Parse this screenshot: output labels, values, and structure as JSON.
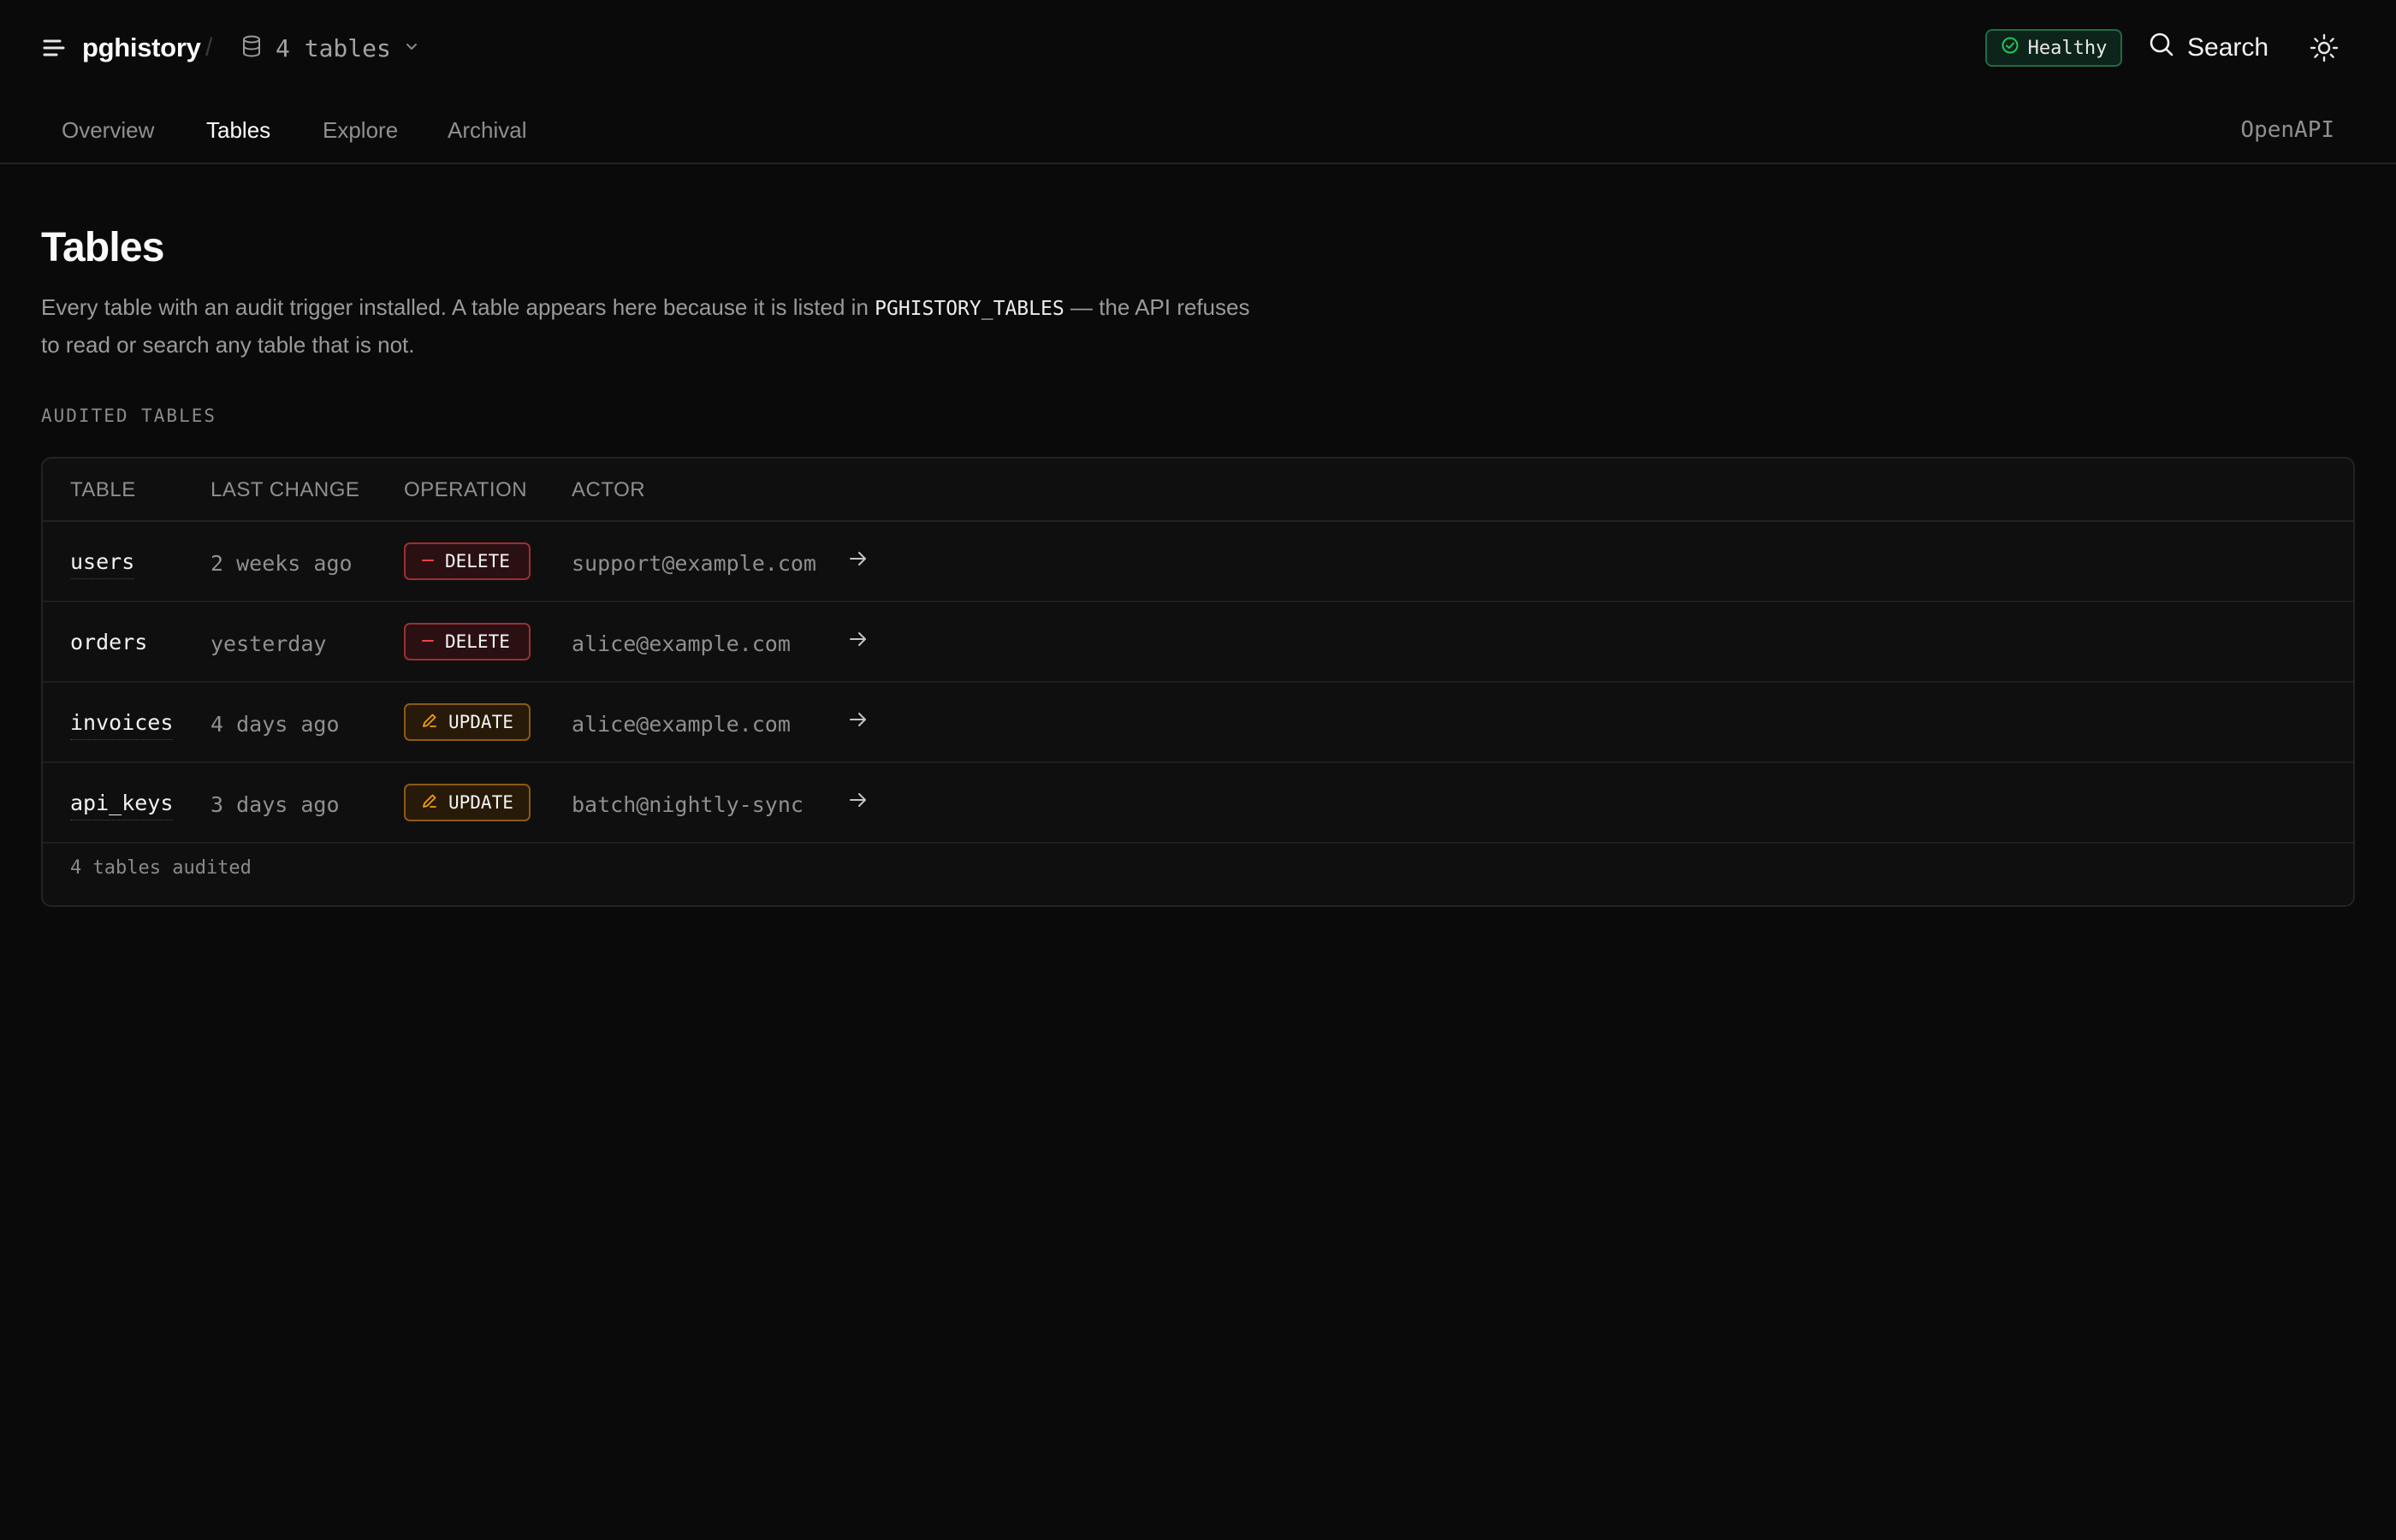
{
  "app": {
    "name": "pghistory",
    "db_selector": "4 tables",
    "health_status": "Healthy",
    "search_label": "Search"
  },
  "nav": {
    "tabs": [
      {
        "label": "Overview"
      },
      {
        "label": "Tables"
      },
      {
        "label": "Explore"
      },
      {
        "label": "Archival"
      }
    ],
    "active_tab": "Tables",
    "right_link": "OpenAPI"
  },
  "page": {
    "title": "Tables",
    "description_before": "Every table with an audit trigger installed. A table appears here because it is listed in ",
    "description_code": "PGHISTORY_TABLES",
    "description_after": " — the API refuses to read or search any table that is not.",
    "section_label": "AUDITED TABLES"
  },
  "table": {
    "columns": [
      "TABLE",
      "LAST CHANGE",
      "OPERATION",
      "ACTOR"
    ],
    "rows": [
      {
        "name": "users",
        "last_change": "2 weeks ago",
        "operation": "DELETE",
        "actor": "support@example.com"
      },
      {
        "name": "orders",
        "last_change": "yesterday",
        "operation": "DELETE",
        "actor": "alice@example.com"
      },
      {
        "name": "invoices",
        "last_change": "4 days ago",
        "operation": "UPDATE",
        "actor": "alice@example.com"
      },
      {
        "name": "api_keys",
        "last_change": "3 days ago",
        "operation": "UPDATE",
        "actor": "batch@nightly-sync"
      }
    ],
    "footer": "4 tables audited"
  },
  "colors": {
    "background": "#0a0a0a",
    "healthy": "#22c55e",
    "delete": "#ef4444",
    "update": "#f59e0b"
  },
  "icons": {
    "menu": "menu-icon",
    "database": "database-icon",
    "chevron": "chevron-down-icon",
    "health": "check-circle-icon",
    "search": "search-icon",
    "theme": "sun-icon",
    "delete_op": "minus-icon",
    "update_op": "pencil-icon",
    "row_link": "arrow-right-icon"
  }
}
